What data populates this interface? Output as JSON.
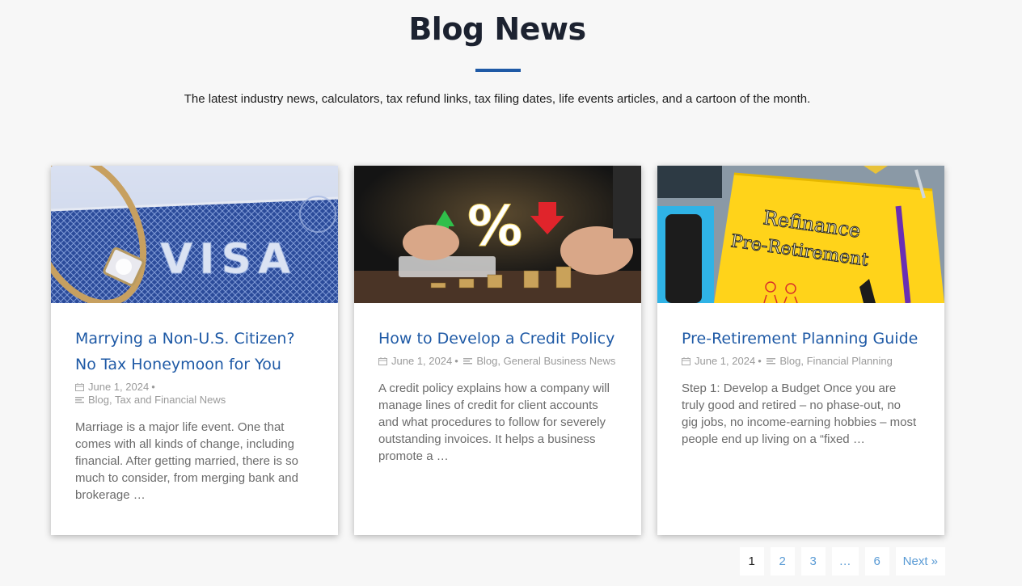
{
  "header": {
    "title": "Blog News",
    "subtitle": "The latest industry news, calculators, tax refund links, tax filing dates, life events articles, and a cartoon of the month."
  },
  "posts": [
    {
      "title": "Marrying a Non-U.S. Citizen? No Tax Honeymoon for You",
      "date": "June 1, 2024",
      "categories": "Blog, Tax and Financial News",
      "excerpt": "Marriage is a major life event. One that comes with all kinds of change, including financial. After getting married, there is so much to consider, from merging bank and brokerage …",
      "image_text": "VISA"
    },
    {
      "title": "How to Develop a Credit Policy",
      "date": "June 1, 2024",
      "categories": "Blog, General Business News",
      "excerpt": "A credit policy explains how a company will manage lines of credit for client accounts and what procedures to follow for severely outstanding invoices. It helps a business promote a …",
      "image_text": "%"
    },
    {
      "title": "Pre-Retirement Planning Guide",
      "date": "June 1, 2024",
      "categories": "Blog, Financial Planning",
      "excerpt": "Step 1: Develop a Budget Once you are truly good and retired – no phase-out, no gig jobs, no income-earning hobbies – most people end up living on a “fixed …",
      "image_text_line1": "Refinance",
      "image_text_line2": "Pre-Retirement"
    }
  ],
  "pagination": {
    "pages": [
      "1",
      "2",
      "3",
      "…",
      "6"
    ],
    "next": "Next »",
    "current": "1"
  },
  "colors": {
    "accent": "#1f5aa6",
    "link": "#5a9bd5",
    "background": "#f7f7f7"
  },
  "icons": {
    "date": "calendar-icon",
    "category": "category-lines-icon"
  }
}
